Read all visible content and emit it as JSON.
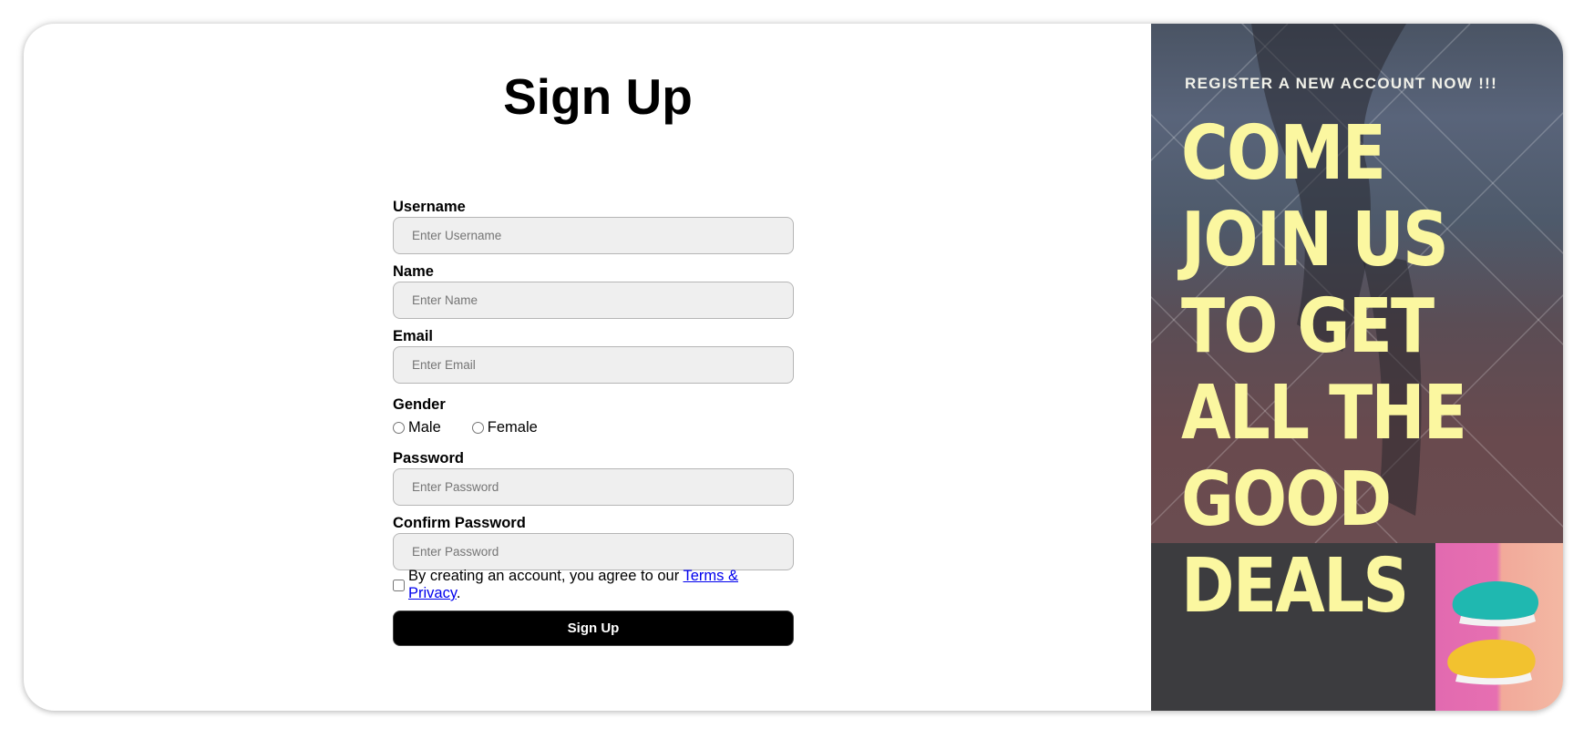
{
  "page": {
    "title": "Sign Up"
  },
  "form": {
    "username": {
      "label": "Username",
      "placeholder": "Enter Username"
    },
    "name": {
      "label": "Name",
      "placeholder": "Enter Name"
    },
    "email": {
      "label": "Email",
      "placeholder": "Enter Email"
    },
    "gender": {
      "label": "Gender",
      "options": [
        "Male",
        "Female"
      ]
    },
    "password": {
      "label": "Password",
      "placeholder": "Enter Password"
    },
    "confirm_password": {
      "label": "Confirm Password",
      "placeholder": "Enter Password"
    },
    "agreement": {
      "text": "By creating an account, you agree to our ",
      "link_text": "Terms & Privacy",
      "suffix": "."
    },
    "submit_label": "Sign Up"
  },
  "promo": {
    "subtitle": "REGISTER A NEW ACCOUNT NOW !!!",
    "headline_lines": [
      "COME",
      "JOIN US",
      "TO GET",
      "ALL THE",
      "GOOD",
      "DEALS"
    ],
    "colors": {
      "headline": "#fbf7a0",
      "bottom_panel": "#3c3c3f"
    }
  }
}
